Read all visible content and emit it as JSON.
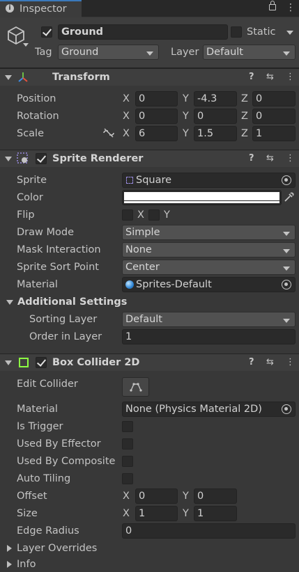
{
  "tab": {
    "title": "Inspector",
    "info_glyph": "i"
  },
  "object": {
    "name": "Ground",
    "static_label": "Static",
    "tag_label": "Tag",
    "tag_value": "Ground",
    "layer_label": "Layer",
    "layer_value": "Default"
  },
  "transform": {
    "title": "Transform",
    "position": {
      "label": "Position",
      "x": "0",
      "y": "-4.3",
      "z": "0"
    },
    "rotation": {
      "label": "Rotation",
      "x": "0",
      "y": "0",
      "z": "0"
    },
    "scale": {
      "label": "Scale",
      "x": "6",
      "y": "1.5",
      "z": "1"
    },
    "axis": {
      "x": "X",
      "y": "Y",
      "z": "Z"
    }
  },
  "sprite_renderer": {
    "title": "Sprite Renderer",
    "sprite_label": "Sprite",
    "sprite_value": "Square",
    "color_label": "Color",
    "color_value": "#ffffff",
    "flip_label": "Flip",
    "flip_x": "X",
    "flip_y": "Y",
    "draw_mode_label": "Draw Mode",
    "draw_mode_value": "Simple",
    "mask_label": "Mask Interaction",
    "mask_value": "None",
    "sort_point_label": "Sprite Sort Point",
    "sort_point_value": "Center",
    "material_label": "Material",
    "material_value": "Sprites-Default",
    "additional_label": "Additional Settings",
    "sorting_layer_label": "Sorting Layer",
    "sorting_layer_value": "Default",
    "order_label": "Order in Layer",
    "order_value": "1"
  },
  "box_collider": {
    "title": "Box Collider 2D",
    "edit_label": "Edit Collider",
    "material_label": "Material",
    "material_value": "None (Physics Material 2D)",
    "trigger_label": "Is Trigger",
    "effector_label": "Used By Effector",
    "composite_label": "Used By Composite",
    "tiling_label": "Auto Tiling",
    "offset_label": "Offset",
    "offset_x": "0",
    "offset_y": "0",
    "size_label": "Size",
    "size_x": "1",
    "size_y": "1",
    "radius_label": "Edge Radius",
    "radius_value": "0",
    "layer_overrides_label": "Layer Overrides",
    "info_label": "Info"
  },
  "colors": {
    "panel": "#383838",
    "header": "#3e3e3e",
    "field": "#2a2a2a",
    "collider_green": "#8cff42"
  }
}
